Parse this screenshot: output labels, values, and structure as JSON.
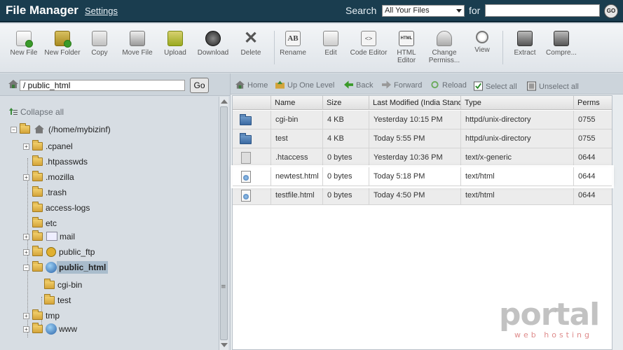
{
  "header": {
    "title": "File Manager",
    "settings_link": "Settings",
    "search_label": "Search",
    "search_scope": "All Your Files",
    "for_label": "for",
    "search_value": "",
    "go_label": "GO"
  },
  "toolbar": {
    "items": [
      {
        "label": "New File",
        "icon": "new-file-icon",
        "color": "#4a9a3a"
      },
      {
        "label": "New Folder",
        "icon": "new-folder-icon",
        "color": "#7aa83a"
      },
      {
        "label": "Copy",
        "icon": "copy-icon",
        "color": "#8a8a8a"
      },
      {
        "label": "Move File",
        "icon": "move-file-icon",
        "color": "#6a6a6a"
      },
      {
        "label": "Upload",
        "icon": "upload-icon",
        "color": "#8aaa2a"
      },
      {
        "label": "Download",
        "icon": "download-icon",
        "color": "#444444"
      },
      {
        "label": "Delete",
        "icon": "delete-icon",
        "color": "#555555"
      },
      {
        "label": "Rename",
        "icon": "rename-icon",
        "color": "#666666"
      },
      {
        "label": "Edit",
        "icon": "edit-icon",
        "color": "#777777"
      },
      {
        "label": "Code Editor",
        "icon": "code-editor-icon",
        "color": "#888888"
      },
      {
        "label": "HTML Editor",
        "icon": "html-editor-icon",
        "color": "#666666"
      },
      {
        "label": "Change Permiss...",
        "icon": "change-permissions-icon",
        "color": "#777777"
      },
      {
        "label": "View",
        "icon": "view-icon",
        "color": "#777777"
      },
      {
        "label": "Extract",
        "icon": "extract-icon",
        "color": "#555555"
      },
      {
        "label": "Compre...",
        "icon": "compress-icon",
        "color": "#555555"
      }
    ]
  },
  "left": {
    "path_value": "/ public_html",
    "go_label": "Go",
    "collapse_label": "Collapse all",
    "tree": [
      {
        "label": "(/home/mybizinf)",
        "icon": "home-folder-icon"
      },
      {
        "label": ".cpanel"
      },
      {
        "label": ".htpasswds"
      },
      {
        "label": ".mozilla"
      },
      {
        "label": ".trash"
      },
      {
        "label": "access-logs"
      },
      {
        "label": "etc"
      },
      {
        "label": "mail",
        "icon": "mail-icon"
      },
      {
        "label": "public_ftp",
        "icon": "ftp-icon"
      },
      {
        "label": "public_html",
        "icon": "globe-icon"
      },
      {
        "label": "cgi-bin"
      },
      {
        "label": "test"
      },
      {
        "label": "tmp"
      },
      {
        "label": "www",
        "icon": "globe-icon"
      }
    ]
  },
  "nav": {
    "home": "Home",
    "up": "Up One Level",
    "back": "Back",
    "forward": "Forward",
    "reload": "Reload",
    "select_all": "Select all",
    "unselect_all": "Unselect all"
  },
  "grid": {
    "columns": [
      "Name",
      "Size",
      "Last Modified (India Standard Time)",
      "Type",
      "Perms"
    ],
    "rows": [
      {
        "name": "cgi-bin",
        "size": "4 KB",
        "modified": "Yesterday 10:15 PM",
        "type": "httpd/unix-directory",
        "perms": "0755",
        "kind": "dir"
      },
      {
        "name": "test",
        "size": "4 KB",
        "modified": "Today 5:55 PM",
        "type": "httpd/unix-directory",
        "perms": "0755",
        "kind": "dir"
      },
      {
        "name": ".htaccess",
        "size": "0 bytes",
        "modified": "Yesterday 10:36 PM",
        "type": "text/x-generic",
        "perms": "0644",
        "kind": "generic"
      },
      {
        "name": "newtest.html",
        "size": "0 bytes",
        "modified": "Today 5:18 PM",
        "type": "text/html",
        "perms": "0644",
        "kind": "html"
      },
      {
        "name": "testfile.html",
        "size": "0 bytes",
        "modified": "Today 4:50 PM",
        "type": "text/html",
        "perms": "0644",
        "kind": "html"
      }
    ]
  },
  "watermark": {
    "main": "portal",
    "sub": "web hosting"
  }
}
